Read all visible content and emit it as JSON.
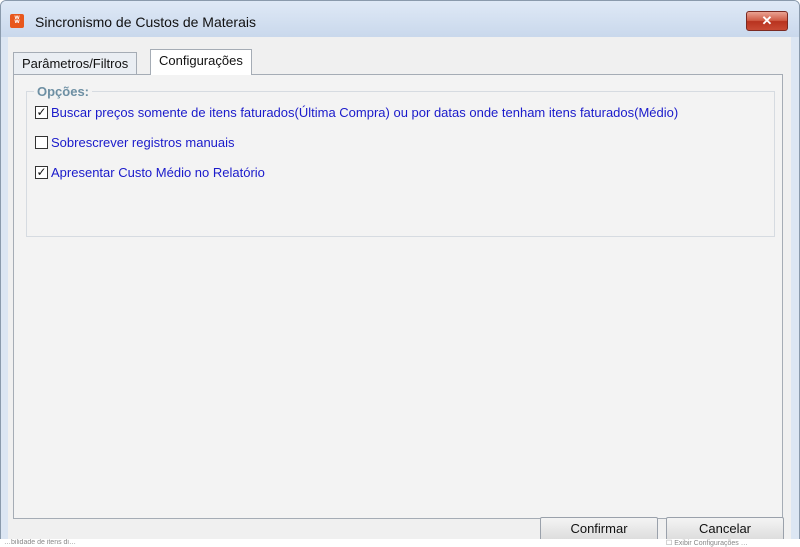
{
  "window": {
    "title": "Sincronismo de Custos de Materais",
    "app_icon_glyph": "ʬ",
    "close_glyph": "✕"
  },
  "tabs": [
    {
      "label": "Parâmetros/Filtros",
      "active": false
    },
    {
      "label": "Configurações",
      "active": true
    }
  ],
  "options_group": {
    "title": "Opções:",
    "items": [
      {
        "label": "Buscar preços somente de itens faturados(Última Compra) ou por datas onde tenham itens faturados(Médio)",
        "checked": true,
        "mark": "✓"
      },
      {
        "label": "Sobrescrever registros manuais",
        "checked": false,
        "mark": ""
      },
      {
        "label": "Apresentar Custo Médio no Relatório",
        "checked": true,
        "mark": "✓"
      }
    ]
  },
  "buttons": {
    "confirm": "Confirmar",
    "cancel": "Cancelar"
  },
  "footer": {
    "left_text": "…bilidade de itens di…",
    "right_text": "☐ Exibir Configurações …"
  },
  "colors": {
    "option_text": "#1a1acb",
    "group_title": "#6d8fa3",
    "close_button": "#c84a34"
  }
}
